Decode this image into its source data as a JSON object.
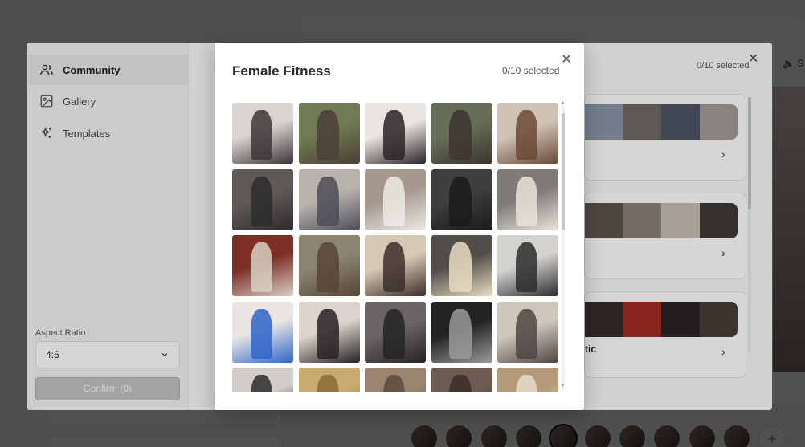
{
  "modal": {
    "title": "Female Fitness",
    "selected_count": "0/10 selected",
    "close_icon": "close-icon",
    "thumbnails": [
      {
        "colors": [
          "#d9d4cf",
          "#3a3736"
        ]
      },
      {
        "colors": [
          "#6f7b52",
          "#4b3f36"
        ]
      },
      {
        "colors": [
          "#e9e6e2",
          "#2a2524"
        ]
      },
      {
        "colors": [
          "#676e57",
          "#3c352f"
        ]
      },
      {
        "colors": [
          "#cfc2b5",
          "#6a4a36"
        ]
      },
      {
        "colors": [
          "#5f5a56",
          "#2d2b2b"
        ]
      },
      {
        "colors": [
          "#b9b3ad",
          "#4c4d56"
        ]
      },
      {
        "colors": [
          "#a5998f",
          "#eeeae5"
        ]
      },
      {
        "colors": [
          "#3e3e40",
          "#1b1b1c"
        ]
      },
      {
        "colors": [
          "#7f7b78",
          "#e8e3dc"
        ]
      },
      {
        "colors": [
          "#7c2f25",
          "#d9cfc3"
        ]
      },
      {
        "colors": [
          "#8a8570",
          "#574538"
        ]
      },
      {
        "colors": [
          "#d6c9b3",
          "#3b2f2a"
        ]
      },
      {
        "colors": [
          "#514e4a",
          "#e9ddc2"
        ]
      },
      {
        "colors": [
          "#d4d2cf",
          "#2d2d2d"
        ]
      },
      {
        "colors": [
          "#e8e5e2",
          "#2f64c9"
        ]
      },
      {
        "colors": [
          "#dad4cc",
          "#262222"
        ]
      },
      {
        "colors": [
          "#6a6665",
          "#262423"
        ]
      },
      {
        "colors": [
          "#232323",
          "#9b9a98"
        ]
      },
      {
        "colors": [
          "#cfc6bc",
          "#4d4743"
        ]
      },
      {
        "colors": [
          "#d1cdc8",
          "#2e2d2c"
        ]
      },
      {
        "colors": [
          "#c9ab6f",
          "#8a6a36"
        ]
      },
      {
        "colors": [
          "#9a8670",
          "#5c4a3d"
        ]
      },
      {
        "colors": [
          "#6e5c52",
          "#3a2d28"
        ]
      },
      {
        "colors": [
          "#b49a78",
          "#e8dccb"
        ]
      }
    ]
  },
  "dialog": {
    "nav": [
      {
        "label": "Community",
        "icon": "users-icon"
      },
      {
        "label": "Gallery",
        "icon": "image-icon"
      },
      {
        "label": "Templates",
        "icon": "sparkles-icon"
      }
    ],
    "aspect_label": "Aspect Ratio",
    "aspect_value": "4:5",
    "confirm_label": "Confirm (0)",
    "selected_count": "0/10 selected",
    "pack_partial_title": "tic"
  },
  "background": {
    "sound_label": "S",
    "add_label": "+"
  }
}
